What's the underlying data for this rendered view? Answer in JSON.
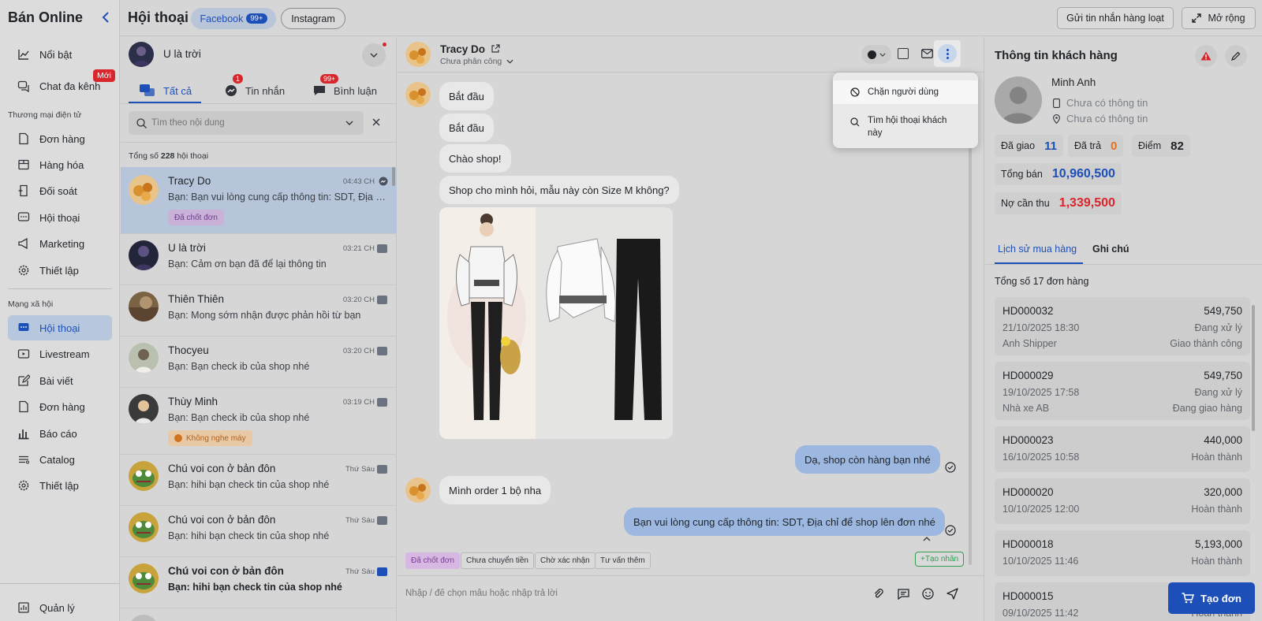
{
  "sidebar": {
    "title": "Bán Online",
    "items_top": [
      {
        "label": "Nổi bật",
        "icon": "chart-line-icon"
      },
      {
        "label": "Chat đa kênh",
        "icon": "chat-multi-icon",
        "badge": "Mới"
      }
    ],
    "section_ecommerce": "Thương mại điện tử",
    "items_ecommerce": [
      {
        "label": "Đơn hàng",
        "icon": "document-icon"
      },
      {
        "label": "Hàng hóa",
        "icon": "box-icon"
      },
      {
        "label": "Đối soát",
        "icon": "reconcile-icon"
      },
      {
        "label": "Hội thoại",
        "icon": "message-icon"
      },
      {
        "label": "Marketing",
        "icon": "megaphone-icon"
      },
      {
        "label": "Thiết lập",
        "icon": "gear-icon"
      }
    ],
    "section_social": "Mạng xã hội",
    "items_social": [
      {
        "label": "Hội thoại",
        "icon": "message-icon",
        "active": true
      },
      {
        "label": "Livestream",
        "icon": "livestream-icon"
      },
      {
        "label": "Bài viết",
        "icon": "edit-icon"
      },
      {
        "label": "Đơn hàng",
        "icon": "document-icon"
      },
      {
        "label": "Báo cáo",
        "icon": "bar-chart-icon"
      },
      {
        "label": "Catalog",
        "icon": "catalog-icon"
      },
      {
        "label": "Thiết lập",
        "icon": "gear-icon"
      }
    ],
    "bottom": {
      "label": "Quản lý",
      "icon": "dashboard-icon"
    }
  },
  "header": {
    "title": "Hội thoại",
    "tab_facebook": "Facebook",
    "tab_facebook_badge": "99+",
    "tab_instagram": "Instagram",
    "bulk_message_button": "Gửi tin nhắn hàng loạt",
    "expand_button": "Mở rộng"
  },
  "convlist": {
    "page_name": "U là trời",
    "tabs": [
      {
        "label": "Tất cả",
        "active": true
      },
      {
        "label": "Tin nhắn",
        "badge": "1"
      },
      {
        "label": "Bình luận",
        "badge": "99+"
      }
    ],
    "search_placeholder": "Tìm theo nội dung",
    "total_prefix": "Tổng số",
    "total_count": "228",
    "total_suffix": "hội thoại",
    "items": [
      {
        "name": "Tracy Do",
        "time": "04:43 CH",
        "message": "Bạn: Bạn vui lòng cung cấp thông tin: SDT, Địa c...",
        "badge": "Đã chốt đơn",
        "badge_color": "#c9b1d8",
        "selected": true,
        "channel": "messenger"
      },
      {
        "name": "U là trời",
        "time": "03:21 CH",
        "message": "Bạn: Cảm ơn bạn đã để lại thông tin",
        "channel": "comment"
      },
      {
        "name": "Thiên Thiên",
        "time": "03:20 CH",
        "message": "Bạn: Mong sớm nhận được phản hồi từ bạn",
        "channel": "comment"
      },
      {
        "name": "Thocyeu",
        "time": "03:20 CH",
        "message": "Bạn: Bạn check ib của shop nhé",
        "channel": "comment"
      },
      {
        "name": "Thùy Minh",
        "time": "03:19 CH",
        "message": "Bạn: Bạn check ib của shop nhé",
        "badge": "Không nghe máy",
        "badge_color": "#e8c9a5",
        "channel": "comment"
      },
      {
        "name": "Chú voi con ở bản đôn",
        "time": "Thứ Sáu",
        "message": "Bạn: hihi bạn check tin của shop nhé",
        "channel": "comment"
      },
      {
        "name": "Chú voi con ở bản đôn",
        "time": "Thứ Sáu",
        "message": "Bạn: hihi bạn check tin của shop nhé",
        "channel": "comment"
      },
      {
        "name": "Chú voi con ở bản đôn",
        "time": "Thứ Sáu",
        "message": "Bạn: hihi bạn check tin của shop nhé",
        "channel": "comment-blue",
        "unread": true
      }
    ]
  },
  "chat": {
    "contact_name": "Tracy Do",
    "assign_status": "Chưa phân công",
    "messages": [
      {
        "from": "customer",
        "text": "Bắt đầu"
      },
      {
        "from": "customer",
        "text": "Bắt đầu"
      },
      {
        "from": "customer",
        "text": "Chào shop!"
      },
      {
        "from": "customer",
        "text": "Shop cho mình hỏi, mẫu này còn Size M không?"
      },
      {
        "from": "shop",
        "text": "Dạ, shop còn hàng bạn nhé"
      },
      {
        "from": "customer",
        "text": "Mình order 1 bộ nha"
      },
      {
        "from": "shop",
        "text": "Bạn vui lòng cung cấp thông tin: SDT, Địa chỉ để shop lên đơn nhé"
      }
    ],
    "quick_tags": [
      "Đã chốt đơn",
      "Chưa chuyển tiền",
      "Chờ xác nhận",
      "Tư vấn thêm"
    ],
    "create_tag_button": "+Tạo nhãn",
    "input_placeholder": "Nhập / để chọn mẫu hoặc nhập trả lời"
  },
  "menu": {
    "items": [
      {
        "label": "Chặn người dùng",
        "icon": "block-icon"
      },
      {
        "label": "Tìm hội thoại khách này",
        "icon": "search-location-icon"
      }
    ]
  },
  "customer": {
    "panel_title": "Thông tin khách hàng",
    "name": "Minh Anh",
    "phone": "Chưa có thông tin",
    "address": "Chưa có thông tin",
    "stats": {
      "delivered_label": "Đã giao",
      "delivered": "11",
      "returned_label": "Đã trả",
      "returned": "0",
      "points_label": "Điểm",
      "points": "82",
      "total_sales_label": "Tổng bán",
      "total_sales": "10,960,500",
      "debt_label": "Nợ cần thu",
      "debt": "1,339,500"
    },
    "tabs": [
      "Lịch sử mua hàng",
      "Ghi chú"
    ],
    "orders_total": "Tổng số 17 đơn hàng",
    "orders": [
      {
        "id": "HD000032",
        "amount": "549,750",
        "date": "21/10/2025 18:30",
        "status": "Đang xử lý",
        "shipper": "Anh Shipper",
        "delivery": "Giao thành công"
      },
      {
        "id": "HD000029",
        "amount": "549,750",
        "date": "19/10/2025 17:58",
        "status": "Đang xử lý",
        "shipper": "Nhà xe AB",
        "delivery": "Đang giao hàng"
      },
      {
        "id": "HD000023",
        "amount": "440,000",
        "date": "16/10/2025 10:58",
        "status": "Hoàn thành"
      },
      {
        "id": "HD000020",
        "amount": "320,000",
        "date": "10/10/2025 12:00",
        "status": "Hoàn thành"
      },
      {
        "id": "HD000018",
        "amount": "5,193,000",
        "date": "10/10/2025 11:46",
        "status": "Hoàn thành"
      },
      {
        "id": "HD000015",
        "amount": "",
        "date": "09/10/2025 11:42",
        "status": "Hoàn thành"
      }
    ],
    "create_order_button": "Tạo đơn"
  },
  "colors": {
    "accent": "#1d4fb8",
    "danger": "#d9262c",
    "orange": "#e8701a"
  }
}
